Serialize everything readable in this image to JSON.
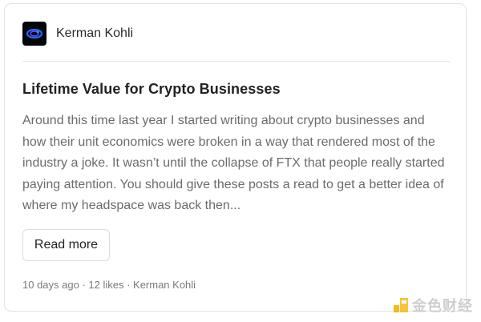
{
  "post": {
    "author": "Kerman Kohli",
    "title": "Lifetime Value for Crypto Businesses",
    "excerpt": "Around this time last year I started writing about crypto businesses and how their unit economics were broken in a way that rendered most of the industry a joke. It wasn’t until the collapse of FTX that people really started paying attention. You should give these posts a read to get a better idea of where my headspace was back then...",
    "read_more_label": "Read more",
    "meta": "10 days ago · 12 likes · Kerman Kohli"
  },
  "watermark": {
    "text": "金色财经"
  },
  "icons": {
    "avatar": "author-avatar-icon",
    "watermark_logo": "golden-logo-icon"
  },
  "colors": {
    "title": "#222222",
    "excerpt": "#6b6b6b",
    "meta": "#7a7a7a",
    "border": "#e2e2e2",
    "watermark_logo": "#f2b400"
  }
}
